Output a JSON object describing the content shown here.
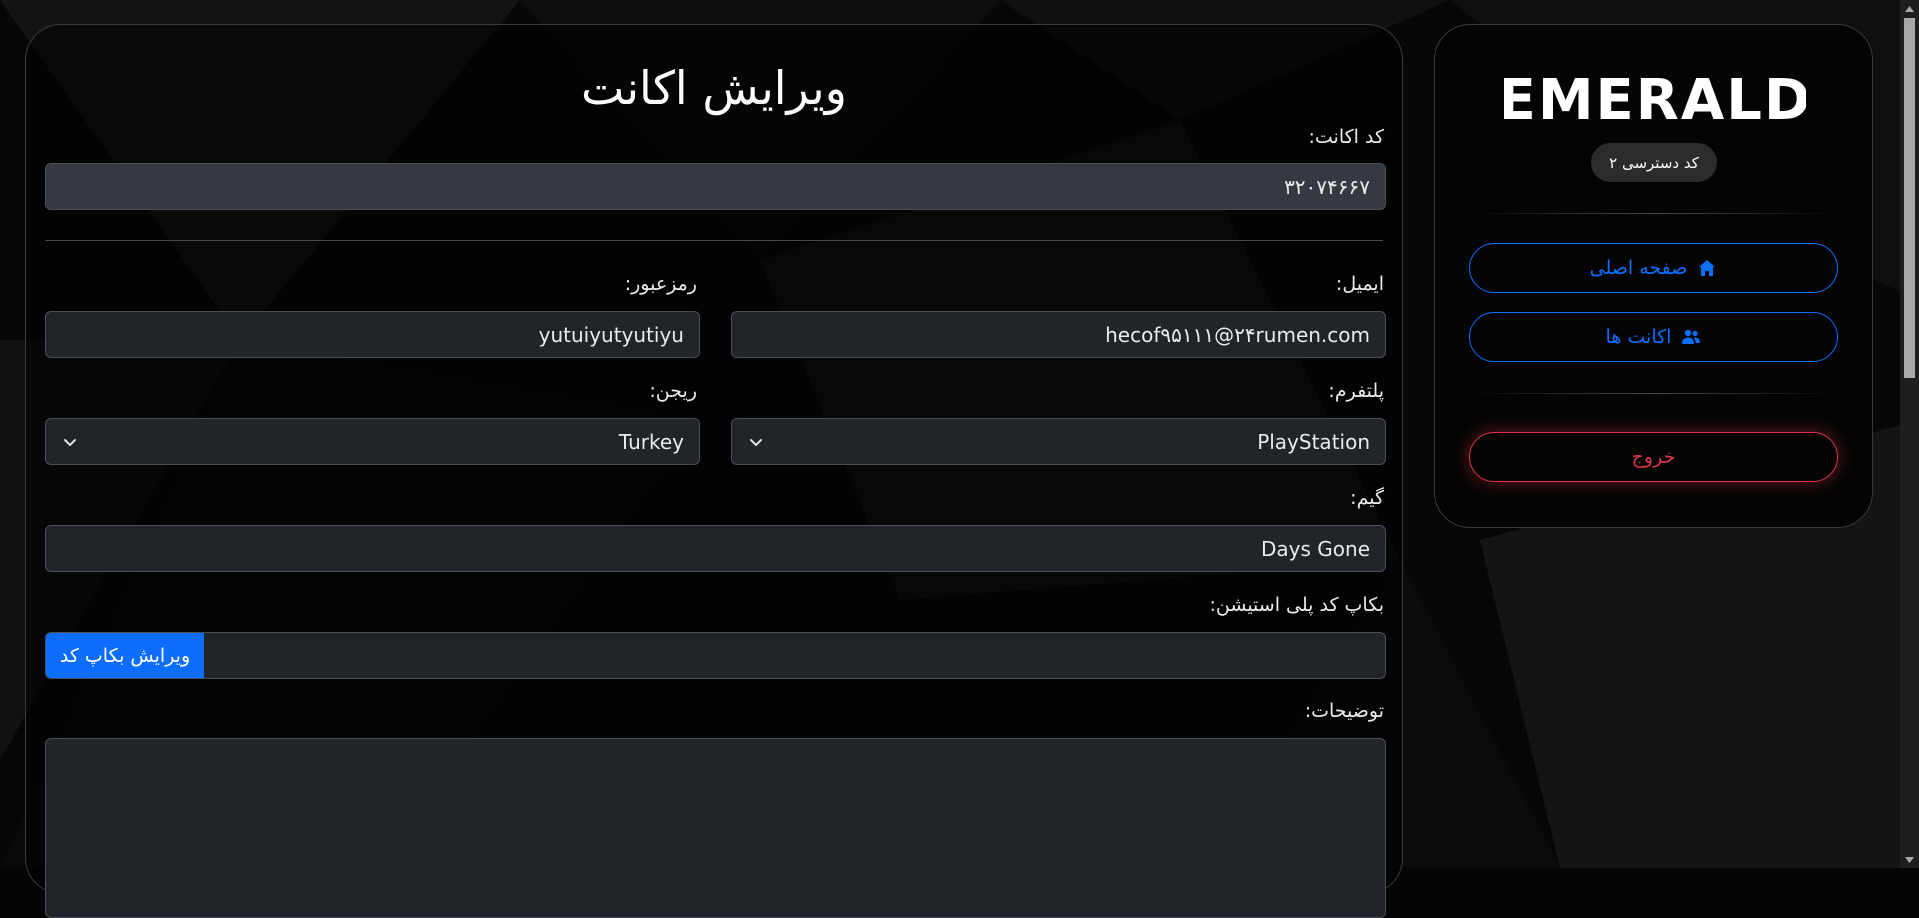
{
  "main": {
    "title": "ویرایش اکانت",
    "account_code_label": "کد اکانت:",
    "account_code_value": "۳۲۰۷۴۶۶۷",
    "email_label": "ایمیل:",
    "email_value": "hecof۹۵۱۱۱@۲۴rumen.com",
    "password_label": "رمزعبور:",
    "password_value": "yutuiyutyutiyu",
    "platform_label": "پلتفرم:",
    "platform_value": "PlayStation",
    "region_label": "ریجن:",
    "region_value": "Turkey",
    "game_label": "گیم:",
    "game_value": "Days Gone",
    "backup_label": "بکاپ کد پلی استیشن:",
    "backup_value": "",
    "backup_button": "ویرایش بکاپ کد",
    "notes_label": "توضیحات:",
    "notes_value": ""
  },
  "sidebar": {
    "logo_text": "EMERALD",
    "access_badge": "کد دسترسی ۲",
    "nav": [
      {
        "label": "صفحه اصلی",
        "icon": "home-icon"
      },
      {
        "label": "اکانت ها",
        "icon": "users-icon"
      }
    ],
    "logout": "خروج"
  },
  "colors": {
    "primary": "#0d6efd",
    "danger": "#dc3545",
    "field_bg": "#212529",
    "readonly_bg": "#343a40",
    "border": "#495057"
  }
}
